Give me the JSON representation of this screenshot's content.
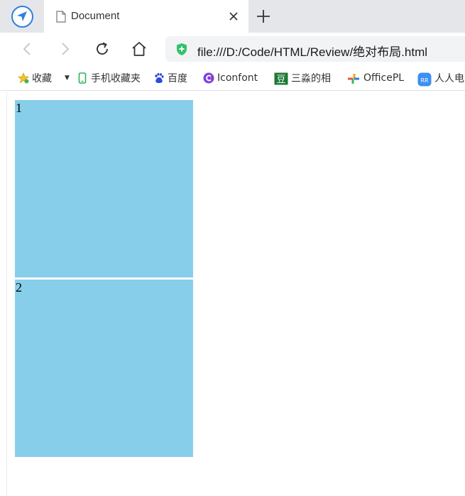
{
  "tab": {
    "title": "Document"
  },
  "address_bar": {
    "url": "file:///D:/Code/HTML/Review/绝对布局.html"
  },
  "bookmarks": [
    {
      "label": "收藏",
      "icon": "star-folder-icon"
    },
    {
      "label": "手机收藏夹",
      "icon": "phone-icon"
    },
    {
      "label": "百度",
      "icon": "baidu-paw-icon"
    },
    {
      "label": "Iconfont",
      "icon": "iconfont-icon"
    },
    {
      "label": "三淼的相",
      "icon": "dou-icon"
    },
    {
      "label": "OfficePL",
      "icon": "officeplus-icon"
    },
    {
      "label": "人人电",
      "icon": "renren-icon"
    }
  ],
  "page": {
    "boxes": [
      {
        "text": "1"
      },
      {
        "text": "2"
      }
    ]
  },
  "colors": {
    "box_fill": "#87ceeb",
    "tabbar_bg": "#e4e6ea",
    "accent": "#2f7fe3"
  }
}
